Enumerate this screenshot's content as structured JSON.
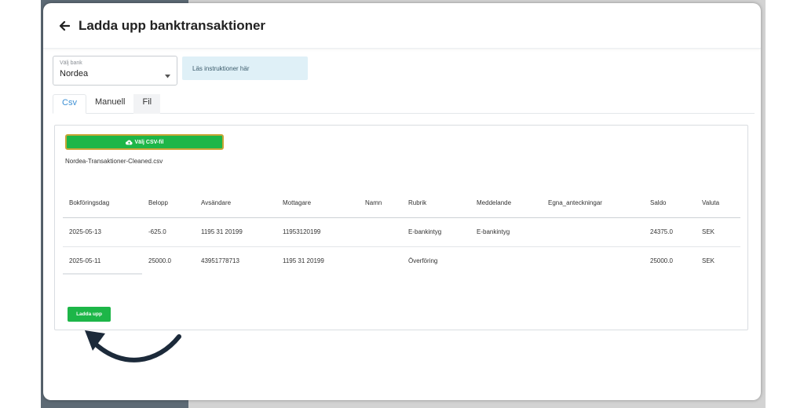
{
  "header": {
    "title": "Ladda upp banktransaktioner",
    "back_icon": "arrow-left-icon"
  },
  "bank_select": {
    "label": "Välj bank",
    "value": "Nordea"
  },
  "info": {
    "text": "Läs instruktioner här"
  },
  "tabs": [
    {
      "label": "Csv",
      "active": true
    },
    {
      "label": "Manuell",
      "active": false
    },
    {
      "label": "Fil",
      "active": false
    }
  ],
  "csv": {
    "button_label": "Välj CSV-fil",
    "button_icon": "cloud-upload-icon",
    "filename": "Nordea-Transaktioner-Cleaned.csv"
  },
  "table": {
    "headers": [
      "Bokföringsdag",
      "Belopp",
      "Avsändare",
      "Mottagare",
      "Namn",
      "Rubrik",
      "Meddelande",
      "Egna_anteckningar",
      "Saldo",
      "Valuta"
    ],
    "rows": [
      [
        "2025-05-13",
        "-625.0",
        "1195 31 20199",
        "11953120199",
        "",
        "E-bankintyg",
        "E-bankintyg",
        "",
        "24375.0",
        "SEK"
      ],
      [
        "2025-05-11",
        "25000.0",
        "43951778713",
        "1195 31 20199",
        "",
        "Överföring",
        "",
        "",
        "25000.0",
        "SEK"
      ]
    ]
  },
  "upload": {
    "button_label": "Ladda upp"
  },
  "colors": {
    "accent_green": "#1db648",
    "tab_active": "#3b8fd4",
    "info_bg": "#dff0f7",
    "arrow": "#1c2a3a"
  }
}
